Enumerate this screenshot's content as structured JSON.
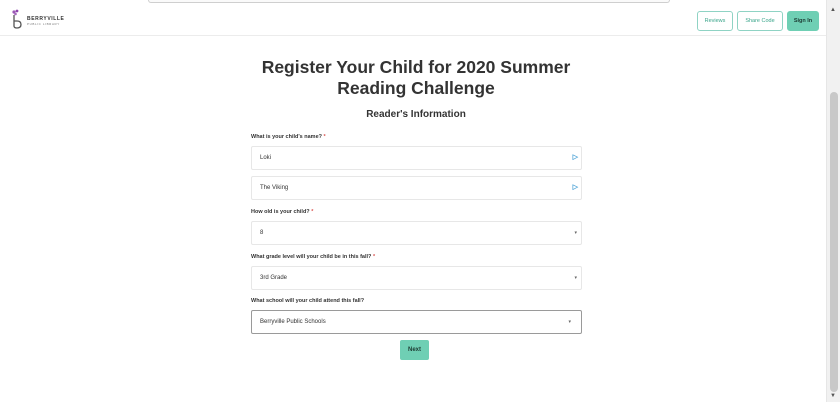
{
  "header": {
    "logo_text": "BERRYVILLE",
    "logo_subtext": "PUBLIC LIBRARY",
    "reviews_label": "Reviews",
    "share_code_label": "Share Code",
    "sign_in_label": "Sign In"
  },
  "main": {
    "title": "Register Your Child for 2020 Summer Reading Challenge",
    "subtitle": "Reader's Information"
  },
  "form": {
    "name_label": "What is your child's name?",
    "required_mark": "*",
    "first_name_value": "Loki",
    "last_name_value": "The Viking",
    "age_label": "How old is your child?",
    "age_value": "8",
    "grade_label": "What grade level will your child be in this fall?",
    "grade_value": "3rd Grade",
    "school_label": "What school will your child attend this fall?",
    "school_value": "Berryville Public Schools",
    "next_label": "Next"
  },
  "icons": {
    "autofill": "contact-card-icon",
    "dropdown": "caret-down-icon"
  },
  "colors": {
    "accent": "#6fcfb4",
    "required": "#d9534f"
  }
}
